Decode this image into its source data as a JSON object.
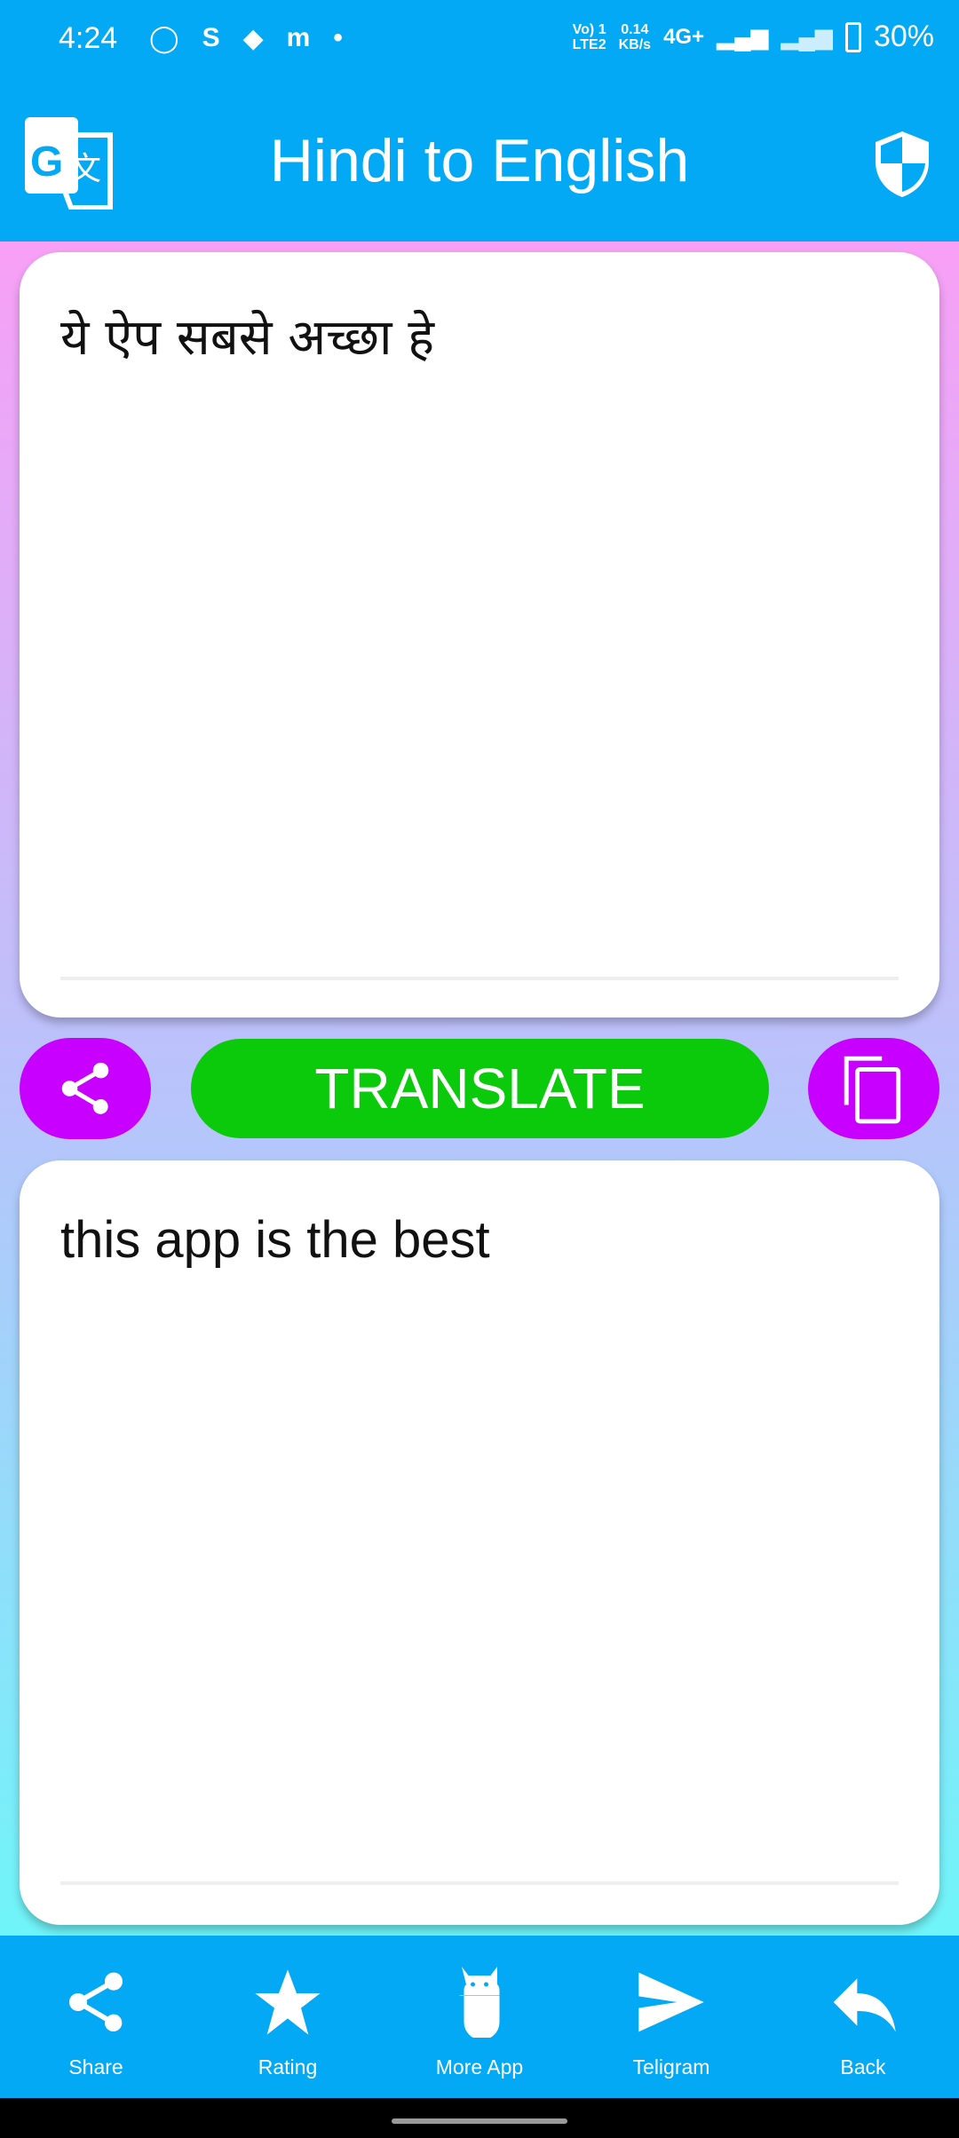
{
  "status_bar": {
    "time": "4:24",
    "volte": "Vo) 1",
    "lte": "LTE2",
    "speed_value": "0.14",
    "speed_unit": "KB/s",
    "network": "4G+",
    "battery": "30%",
    "notification_icons": [
      "whatsapp-icon",
      "s-app-icon",
      "drive-icon",
      "m-app-icon",
      "dot-icon"
    ]
  },
  "header": {
    "title": "Hindi to English",
    "logo_icon": "google-translate-icon",
    "right_icon": "shield-icon"
  },
  "input": {
    "value": "ये ऐप सबसे अच्छा हे"
  },
  "actions": {
    "translate_label": "TRANSLATE",
    "share_icon": "share-icon",
    "copy_icon": "copy-icon"
  },
  "output": {
    "value": "this app is the best"
  },
  "bottom_nav": {
    "items": [
      {
        "label": "Share",
        "icon": "share-icon"
      },
      {
        "label": "Rating",
        "icon": "star-icon"
      },
      {
        "label": "More App",
        "icon": "android-icon"
      },
      {
        "label": "Teligram",
        "icon": "send-icon"
      },
      {
        "label": "Back",
        "icon": "reply-icon"
      }
    ]
  },
  "colors": {
    "primary": "#03A9F4",
    "action_purple": "#C800FF",
    "translate_green": "#0BC90B"
  }
}
